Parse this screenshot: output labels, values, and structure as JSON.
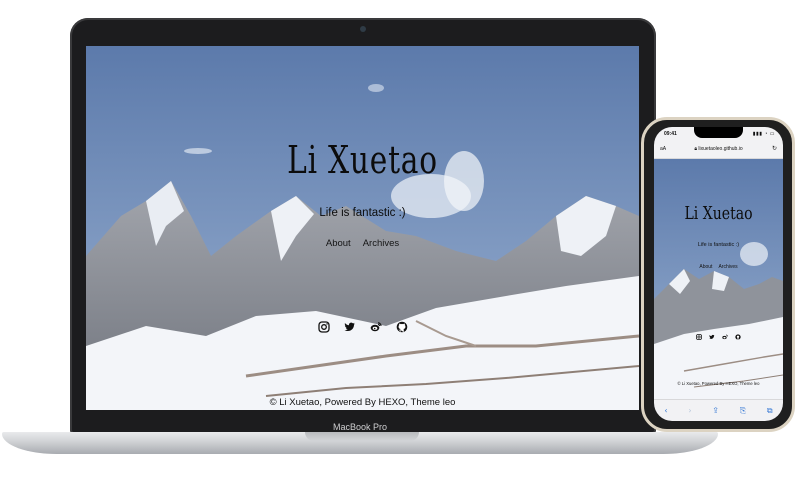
{
  "site": {
    "title": "Li Xuetao",
    "subtitle": "Life is fantastic :)",
    "nav": [
      {
        "label": "About"
      },
      {
        "label": "Archives"
      }
    ],
    "social_icons": [
      "instagram-icon",
      "twitter-icon",
      "weibo-icon",
      "github-icon"
    ],
    "footer": "© Li Xuetao, Powered By HEXO, Theme leo"
  },
  "laptop": {
    "brand": "MacBook Pro"
  },
  "phone": {
    "time": "09:41",
    "url_prefix": "aA",
    "url": "lixuetaoleo.github.io",
    "toolbar_icons": [
      "back-icon",
      "forward-icon",
      "share-icon",
      "bookmarks-icon",
      "tabs-icon"
    ]
  },
  "colors": {
    "sky_top": "#5f7fb0",
    "sky_bottom": "#8aa6cc",
    "snow": "#f2f4f8",
    "rock": "#8c8f97",
    "device_frame": "#1c1c1e",
    "phone_frame": "#dcd3c2",
    "link_blue": "#3a7bd5"
  }
}
